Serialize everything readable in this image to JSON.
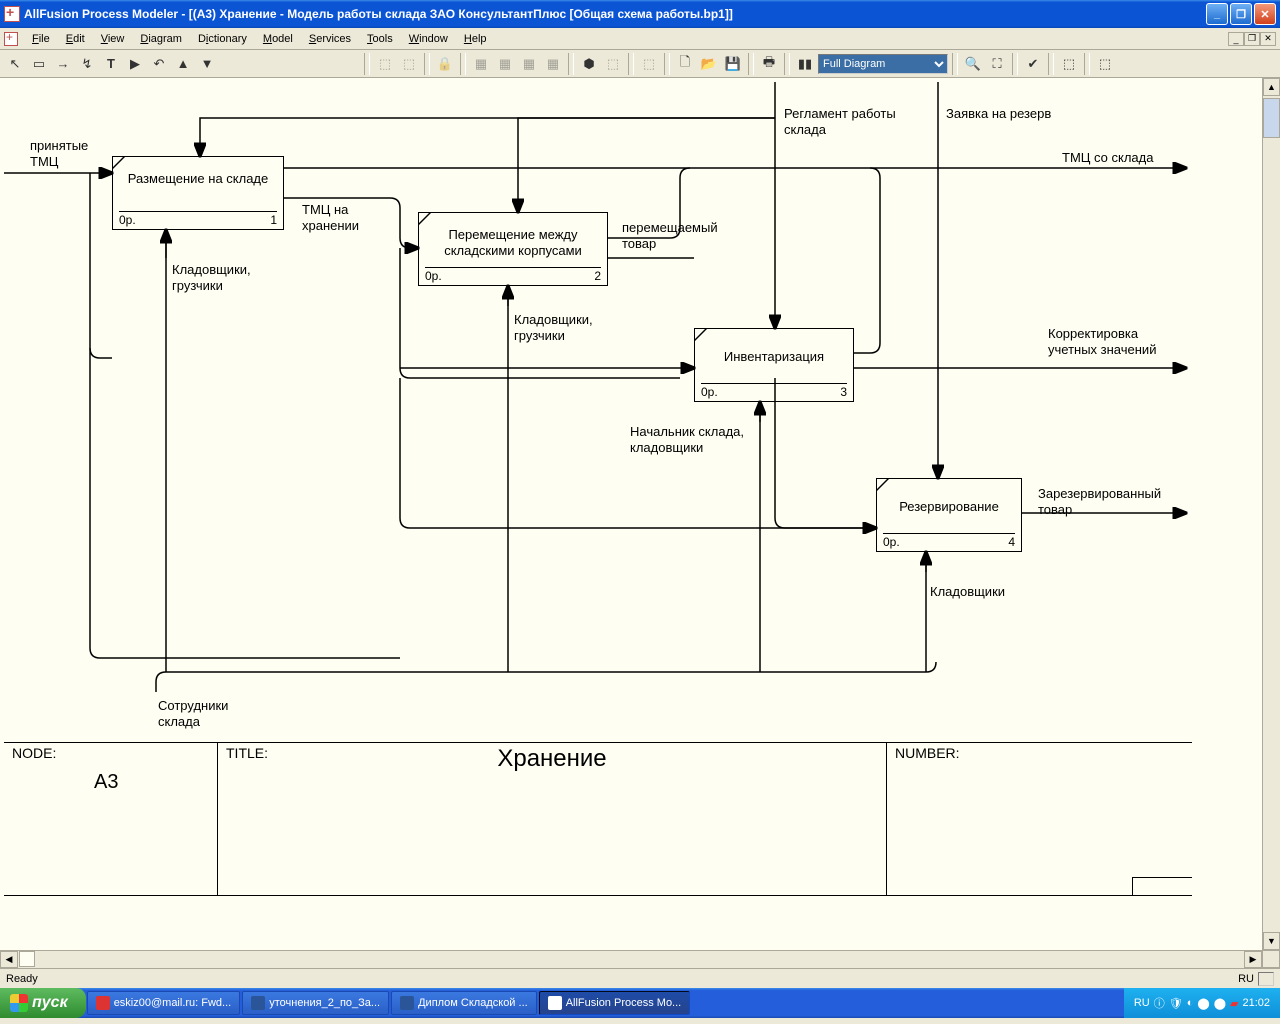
{
  "title": "AllFusion Process Modeler - [(A3) Хранение - Модель работы склада ЗАО КонсультантПлюс  [Общая схема работы.bp1]]",
  "menu": {
    "file": "File",
    "edit": "Edit",
    "view": "View",
    "diagram": "Diagram",
    "dictionary": "Dictionary",
    "model": "Model",
    "services": "Services",
    "tools": "Tools",
    "window": "Window",
    "help": "Help"
  },
  "toolbar": {
    "view_select": "Full Diagram"
  },
  "labels": {
    "input1": "принятые\nТМЦ",
    "control1": "Регламент работы\nсклада",
    "control2": "Заявка на резерв",
    "output1": "ТМЦ со склада",
    "output2": "Корректировка\nучетных значений",
    "output3": "Зарезервированный\nтовар",
    "link1": "ТМЦ на\nхранении",
    "link2": "перемещаемый\nтовар",
    "mech1": "Кладовщики,\nгрузчики",
    "mech2": "Кладовщики,\nгрузчики",
    "mech3": "Начальник склада,\nкладовщики",
    "mech4": "Кладовщики",
    "mech_shared": "Сотрудники\nсклада"
  },
  "boxes": {
    "b1": {
      "title": "Размещение на складе",
      "cost": "0р.",
      "num": "1"
    },
    "b2": {
      "title": "Перемещение между\nскладскими корпусами",
      "cost": "0р.",
      "num": "2"
    },
    "b3": {
      "title": "Инвентаризация",
      "cost": "0р.",
      "num": "3"
    },
    "b4": {
      "title": "Резервирование",
      "cost": "0р.",
      "num": "4"
    }
  },
  "frame": {
    "node_label": "NODE:",
    "node_value": "A3",
    "title_label": "TITLE:",
    "title_value": "Хранение",
    "number_label": "NUMBER:"
  },
  "status": {
    "ready": "Ready",
    "lang": "RU"
  },
  "taskbar": {
    "start": "пуск",
    "tasks": [
      "eskiz00@mail.ru: Fwd...",
      "уточнения_2_по_За...",
      "Диплом Складской ...",
      "AllFusion Process Mo..."
    ],
    "clock": "21:02"
  }
}
